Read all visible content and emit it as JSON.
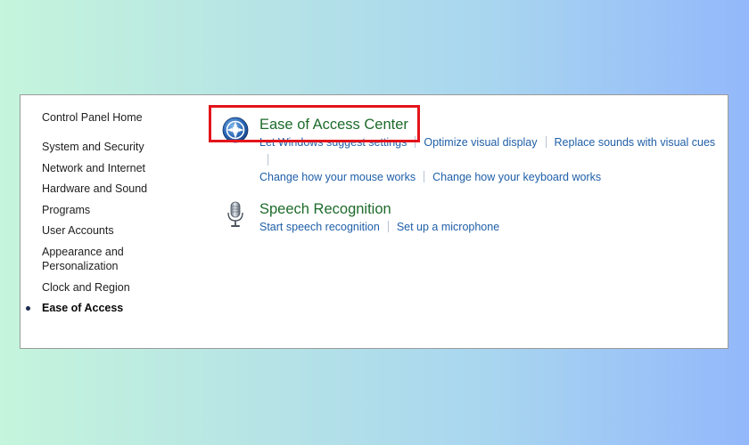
{
  "sidebar": {
    "home": "Control Panel Home",
    "items": [
      {
        "label": "System and Security",
        "active": false
      },
      {
        "label": "Network and Internet",
        "active": false
      },
      {
        "label": "Hardware and Sound",
        "active": false
      },
      {
        "label": "Programs",
        "active": false
      },
      {
        "label": "User Accounts",
        "active": false
      },
      {
        "label": "Appearance and Personalization",
        "active": false
      },
      {
        "label": "Clock and Region",
        "active": false
      },
      {
        "label": "Ease of Access",
        "active": true
      }
    ]
  },
  "main": {
    "categories": [
      {
        "title": "Ease of Access Center",
        "icon": "ease-of-access-icon",
        "links": [
          "Let Windows suggest settings",
          "Optimize visual display",
          "Replace sounds with visual cues",
          "Change how your mouse works",
          "Change how your keyboard works"
        ]
      },
      {
        "title": "Speech Recognition",
        "icon": "microphone-icon",
        "links": [
          "Start speech recognition",
          "Set up a microphone"
        ]
      }
    ]
  },
  "colors": {
    "highlight": "#e3141b",
    "link": "#1f5fa8",
    "category_title": "#1d6b2a"
  }
}
